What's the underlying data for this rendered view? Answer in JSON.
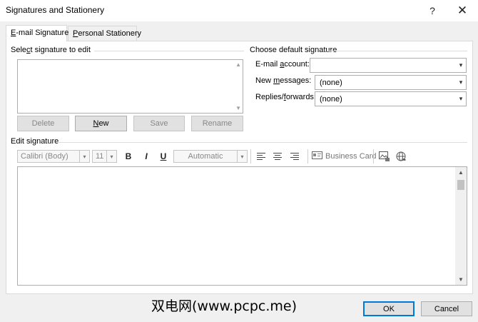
{
  "window": {
    "title": "Signatures and Stationery",
    "help_glyph": "?",
    "close_glyph": "✕"
  },
  "tabs": [
    {
      "hot": "E",
      "rest": "-mail Signature",
      "active": true
    },
    {
      "hot": "P",
      "rest": "ersonal Stationery",
      "active": false
    }
  ],
  "select_section": {
    "pre": "Sele",
    "hot": "c",
    "post": "t signature to edit"
  },
  "signature_buttons": {
    "delete": "Delete",
    "new_hot": "N",
    "new_rest": "ew",
    "save": "Save",
    "rename": "Rename"
  },
  "default_section": {
    "label": "Choose default signature",
    "email_account": {
      "pre": "E-mail ",
      "hot": "a",
      "post": "ccount:",
      "value": ""
    },
    "new_messages": {
      "pre": "New ",
      "hot": "m",
      "post": "essages:",
      "value": "(none)"
    },
    "replies": {
      "pre": "Replies/",
      "hot": "f",
      "post": "orwards:",
      "value": "(none)"
    }
  },
  "edit_section": {
    "label": "Edit signature",
    "font_name": "Calibri (Body)",
    "font_size": "11",
    "bold": "B",
    "italic": "I",
    "underline": "U",
    "color": "Automatic",
    "business_card": "Business Card"
  },
  "watermark": "双电网(www.pcpc.me)",
  "dialog_buttons": {
    "ok": "OK",
    "cancel": "Cancel"
  },
  "colors": {
    "focus_border": "#0078d7",
    "background": "#f0f0f0",
    "panel": "#ffffff"
  }
}
